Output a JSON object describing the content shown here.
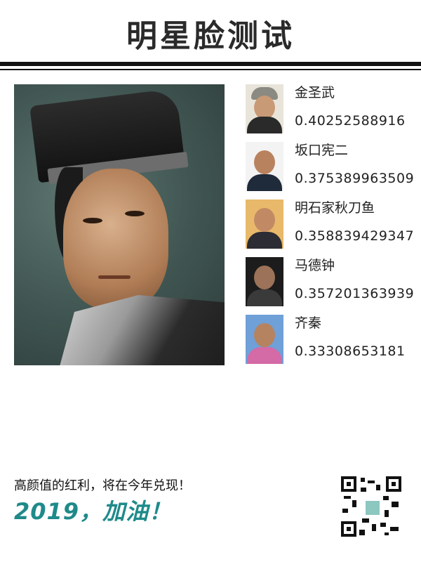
{
  "header": {
    "title": "明星脸测试"
  },
  "matches": [
    {
      "name": "金圣武",
      "score": "0.40252588916"
    },
    {
      "name": "坂口宪二",
      "score": "0.375389963509"
    },
    {
      "name": "明石家秋刀鱼",
      "score": "0.358839429347"
    },
    {
      "name": "马德钟",
      "score": "0.357201363939"
    },
    {
      "name": "齐秦",
      "score": "0.33308653181"
    }
  ],
  "footer": {
    "slogan": "高颜值的红利，将在今年兑现！",
    "cheer": "2019，加油！"
  },
  "colors": {
    "accent": "#1f8a8a",
    "rule": "#111111"
  }
}
